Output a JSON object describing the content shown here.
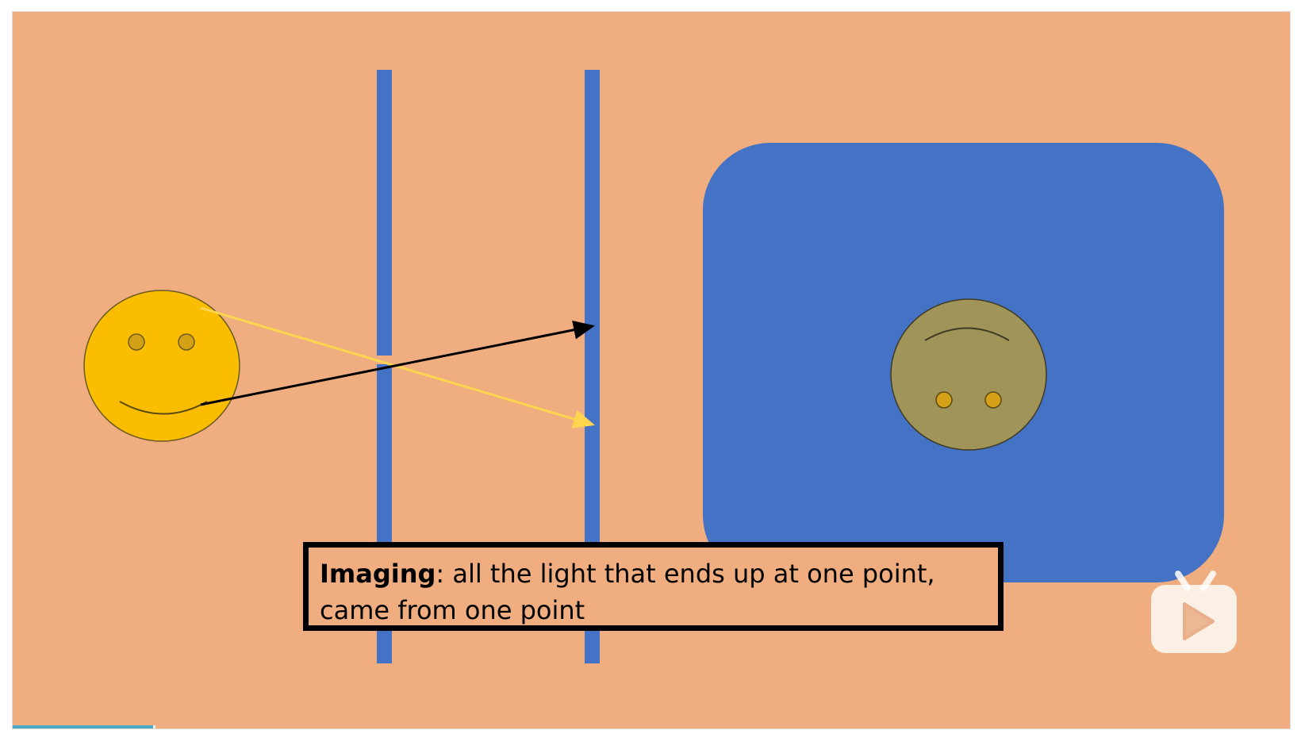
{
  "caption": {
    "bold_term": "Imaging",
    "line1_rest": ": all the light that ends up at one point,",
    "line2": "came from one point"
  },
  "colors": {
    "background": "#efad80",
    "barrier": "#4472c4",
    "screen_box": "#4472c4",
    "object_face": "#fbbd00",
    "image_face": "#a19459",
    "ray_yellow": "#ffd54f",
    "ray_black": "#000000",
    "caption_border": "#000000"
  },
  "icons": {
    "watermark": "bilibili-play-icon"
  },
  "video": {
    "progress": 0.11
  }
}
